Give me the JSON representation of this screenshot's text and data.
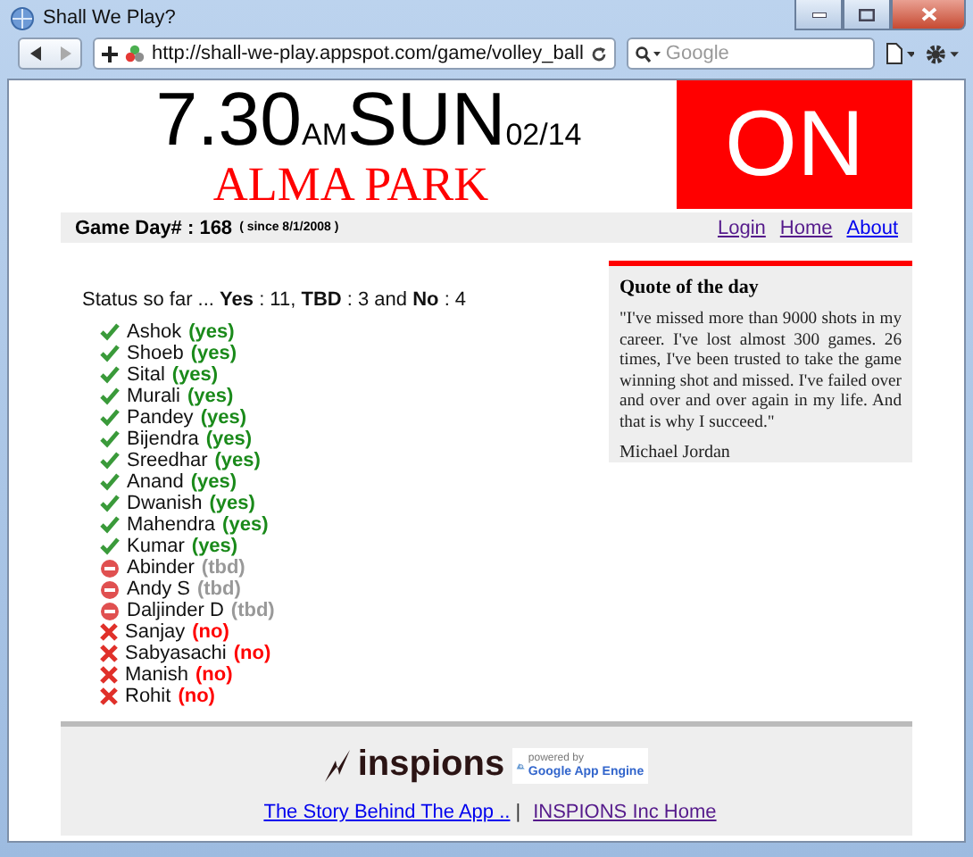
{
  "browser": {
    "title": "Shall We Play?",
    "url": "http://shall-we-play.appspot.com/game/volley_ball",
    "search_placeholder": "Google"
  },
  "header": {
    "time": "7.30",
    "ampm": "AM",
    "day": "SUN",
    "date": "02/14",
    "venue": "ALMA PARK",
    "status": "ON"
  },
  "info_bar": {
    "label": "Game Day# : 168",
    "since": "( since 8/1/2008 )",
    "links": [
      {
        "label": "Login",
        "visited": true
      },
      {
        "label": "Home",
        "visited": true
      },
      {
        "label": "About",
        "visited": false
      }
    ]
  },
  "status_summary": "Status so far ... **Yes** : 11, **TBD** : 3 and **No** : 4",
  "players": [
    {
      "name": "Ashok",
      "response": "(yes)",
      "kind": "yes"
    },
    {
      "name": "Shoeb",
      "response": "(yes)",
      "kind": "yes"
    },
    {
      "name": "Sital",
      "response": "(yes)",
      "kind": "yes"
    },
    {
      "name": "Murali",
      "response": "(yes)",
      "kind": "yes"
    },
    {
      "name": "Pandey",
      "response": "(yes)",
      "kind": "yes"
    },
    {
      "name": "Bijendra",
      "response": "(yes)",
      "kind": "yes"
    },
    {
      "name": "Sreedhar",
      "response": "(yes)",
      "kind": "yes"
    },
    {
      "name": "Anand",
      "response": "(yes)",
      "kind": "yes"
    },
    {
      "name": "Dwanish",
      "response": "(yes)",
      "kind": "yes"
    },
    {
      "name": "Mahendra",
      "response": "(yes)",
      "kind": "yes"
    },
    {
      "name": "Kumar",
      "response": "(yes)",
      "kind": "yes"
    },
    {
      "name": "Abinder",
      "response": "(tbd)",
      "kind": "tbd"
    },
    {
      "name": "Andy S",
      "response": "(tbd)",
      "kind": "tbd"
    },
    {
      "name": "Daljinder D",
      "response": "(tbd)",
      "kind": "tbd"
    },
    {
      "name": "Sanjay",
      "response": "(no)",
      "kind": "no"
    },
    {
      "name": "Sabyasachi",
      "response": "(no)",
      "kind": "no"
    },
    {
      "name": "Manish",
      "response": "(no)",
      "kind": "no"
    },
    {
      "name": "Rohit",
      "response": "(no)",
      "kind": "no"
    }
  ],
  "quote": {
    "title": "Quote of the day",
    "text": "\"I've missed more than 9000 shots in my career. I've lost almost 300 games. 26 times, I've been trusted to take the game winning shot and missed. I've failed over and over and over again in my life. And that is why I succeed.\"",
    "author": "Michael Jordan"
  },
  "footer": {
    "logo": "inspions",
    "badge_top": "powered by",
    "badge_bottom": "Google App Engine",
    "separator": "|",
    "links": [
      {
        "label": "The Story Behind The App ..",
        "visited": false
      },
      {
        "label": "INSPIONS Inc Home",
        "visited": true
      }
    ]
  }
}
